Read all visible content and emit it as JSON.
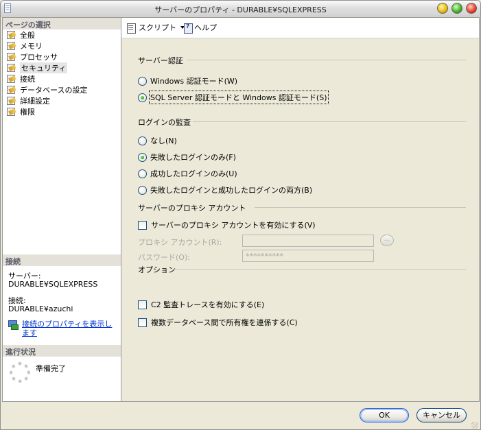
{
  "window": {
    "title": "サーバーのプロパティ - DURABLE¥SQLEXPRESS"
  },
  "left_panel": {
    "pages_header": "ページの選択",
    "pages": [
      {
        "label": "全般",
        "icon": "properties-icon"
      },
      {
        "label": "メモリ",
        "icon": "properties-icon"
      },
      {
        "label": "プロセッサ",
        "icon": "properties-icon"
      },
      {
        "label": "セキュリティ",
        "icon": "properties-icon",
        "selected": true
      },
      {
        "label": "接続",
        "icon": "properties-icon"
      },
      {
        "label": "データベースの設定",
        "icon": "properties-icon"
      },
      {
        "label": "詳細設定",
        "icon": "properties-icon"
      },
      {
        "label": "権限",
        "icon": "properties-icon"
      }
    ],
    "connection_header": "接続",
    "server_label": "サーバー:",
    "server_value": "DURABLE¥SQLEXPRESS",
    "connection_label": "接続:",
    "connection_value": "DURABLE¥azuchi",
    "view_properties_link": "接続のプロパティを表示します",
    "progress_header": "進行状況",
    "progress_status": "準備完了"
  },
  "toolbar": {
    "script_label": "スクリプト",
    "help_label": "ヘルプ"
  },
  "server_auth": {
    "title": "サーバー認証",
    "options": [
      {
        "label": "Windows 認証モード(W)",
        "checked": false
      },
      {
        "label": "SQL Server 認証モードと Windows 認証モード(S)",
        "checked": true
      }
    ]
  },
  "login_audit": {
    "title": "ログインの監査",
    "options": [
      {
        "label": "なし(N)",
        "checked": false
      },
      {
        "label": "失敗したログインのみ(F)",
        "checked": true
      },
      {
        "label": "成功したログインのみ(U)",
        "checked": false
      },
      {
        "label": "失敗したログインと成功したログインの両方(B)",
        "checked": false
      }
    ]
  },
  "proxy": {
    "title": "サーバーのプロキシ アカウント",
    "enable_label": "サーバーのプロキシ アカウントを有効にする(V)",
    "account_label": "プロキシ アカウント(R):",
    "account_value": "",
    "password_label": "パスワード(O):",
    "password_value": "**********",
    "browse_label": "..."
  },
  "options": {
    "title": "オプション",
    "c2_audit_label": "C2 監査トレースを有効にする(E)",
    "cross_db_label": "複数データベース間で所有権を連係する(C)"
  },
  "buttons": {
    "ok": "OK",
    "cancel": "キャンセル"
  },
  "colors": {
    "window_bg": "#ece9d8",
    "link": "#0033cc",
    "radio_checked": "#21a121",
    "ok_border": "#2a5ac8"
  }
}
